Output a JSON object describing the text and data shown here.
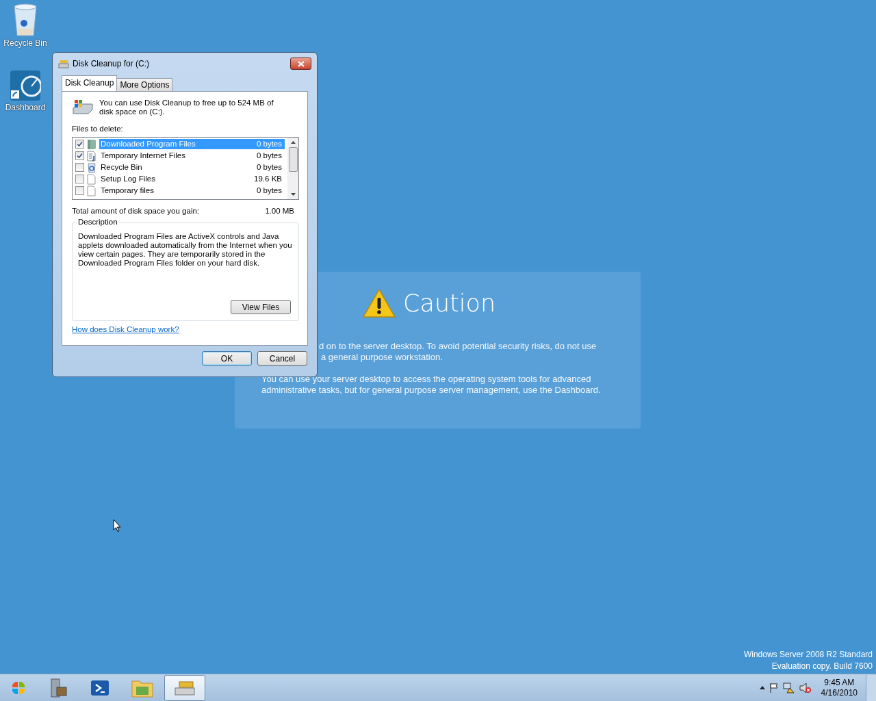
{
  "desktop_icons": [
    {
      "label": "Recycle Bin",
      "kind": "recycle"
    },
    {
      "label": "Dashboard",
      "kind": "dashboard"
    }
  ],
  "caution": {
    "title": "Caution",
    "paragraphs": [
      [
        "d on to the server desktop. To avoid potential security risks, do not use",
        "a general purpose workstation."
      ],
      [
        "You can use your server desktop to access the operating system tools for advanced",
        "administrative tasks, but for general purpose server management, use the Dashboard."
      ]
    ]
  },
  "dialog": {
    "title": "Disk Cleanup for  (C:)",
    "tabs": [
      {
        "label": "Disk Cleanup",
        "selected": true
      },
      {
        "label": "More Options",
        "selected": false
      }
    ],
    "intro": "You can use Disk Cleanup to free up to 524 MB of disk space on  (C:).",
    "files_label": "Files to delete:",
    "files": [
      {
        "name": "Downloaded Program Files",
        "size": "0 bytes",
        "checked": true,
        "selected": true,
        "kind": "folder"
      },
      {
        "name": "Temporary Internet Files",
        "size": "0 bytes",
        "checked": true,
        "selected": false,
        "kind": "webdoc"
      },
      {
        "name": "Recycle Bin",
        "size": "0 bytes",
        "checked": false,
        "selected": false,
        "kind": "recycle"
      },
      {
        "name": "Setup Log Files",
        "size": "19.6 KB",
        "checked": false,
        "selected": false,
        "kind": "page"
      },
      {
        "name": "Temporary files",
        "size": "0 bytes",
        "checked": false,
        "selected": false,
        "kind": "page"
      }
    ],
    "total_label": "Total amount of disk space you gain:",
    "total_value": "1.00 MB",
    "description_legend": "Description",
    "description": "Downloaded Program Files are ActiveX controls and Java applets downloaded automatically from the Internet when you view certain pages. They are temporarily stored in the Downloaded Program Files folder on your hard disk.",
    "view_files_button": "View Files",
    "help_link": "How does Disk Cleanup work?",
    "buttons": [
      {
        "label": "OK",
        "kind": "default"
      },
      {
        "label": "Cancel",
        "kind": "normal"
      }
    ]
  },
  "watermark_os": [
    "Windows Server 2008 R2 Standard",
    "Evaluation copy. Build 7600"
  ],
  "taskbar": {
    "items": [
      {
        "kind": "server",
        "active": false
      },
      {
        "kind": "shell",
        "active": false
      },
      {
        "kind": "explorer",
        "active": false
      },
      {
        "kind": "cleanup",
        "active": true
      }
    ],
    "clock": {
      "time": "9:45 AM",
      "date": "4/16/2010"
    }
  }
}
